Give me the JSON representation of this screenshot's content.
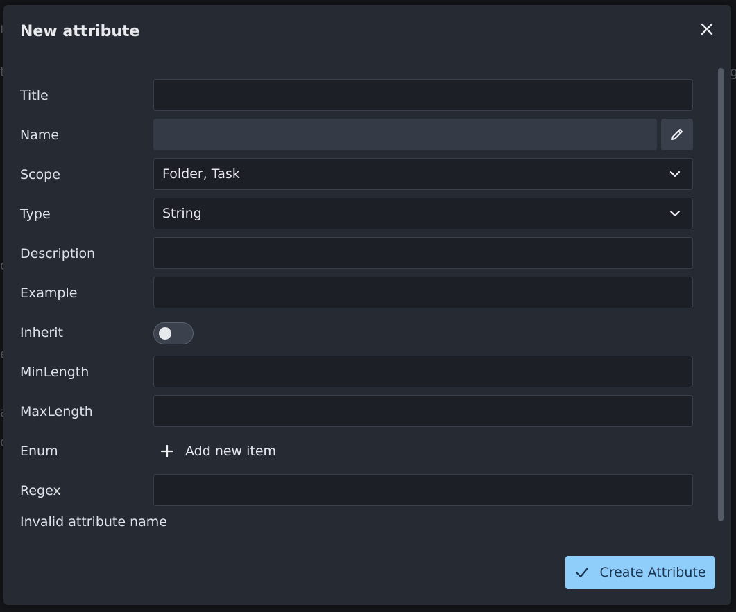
{
  "dialog": {
    "title": "New attribute",
    "close_icon": "close-icon"
  },
  "fields": {
    "title": {
      "label": "Title",
      "value": ""
    },
    "name": {
      "label": "Name",
      "value": "",
      "edit_icon": "pencil-icon"
    },
    "scope": {
      "label": "Scope",
      "value": "Folder, Task"
    },
    "type": {
      "label": "Type",
      "value": "String"
    },
    "description": {
      "label": "Description",
      "value": ""
    },
    "example": {
      "label": "Example",
      "value": ""
    },
    "inherit": {
      "label": "Inherit",
      "checked": false
    },
    "min_length": {
      "label": "MinLength",
      "value": ""
    },
    "max_length": {
      "label": "MaxLength",
      "value": ""
    },
    "enum": {
      "label": "Enum",
      "add_label": "Add new item"
    },
    "regex": {
      "label": "Regex",
      "value": ""
    }
  },
  "error_message": "Invalid attribute name",
  "footer": {
    "create_label": "Create Attribute",
    "create_icon": "check-icon"
  },
  "colors": {
    "dialog_bg": "#262b33",
    "input_bg": "#1c1f26",
    "primary_button": "#8fcdfb"
  }
}
